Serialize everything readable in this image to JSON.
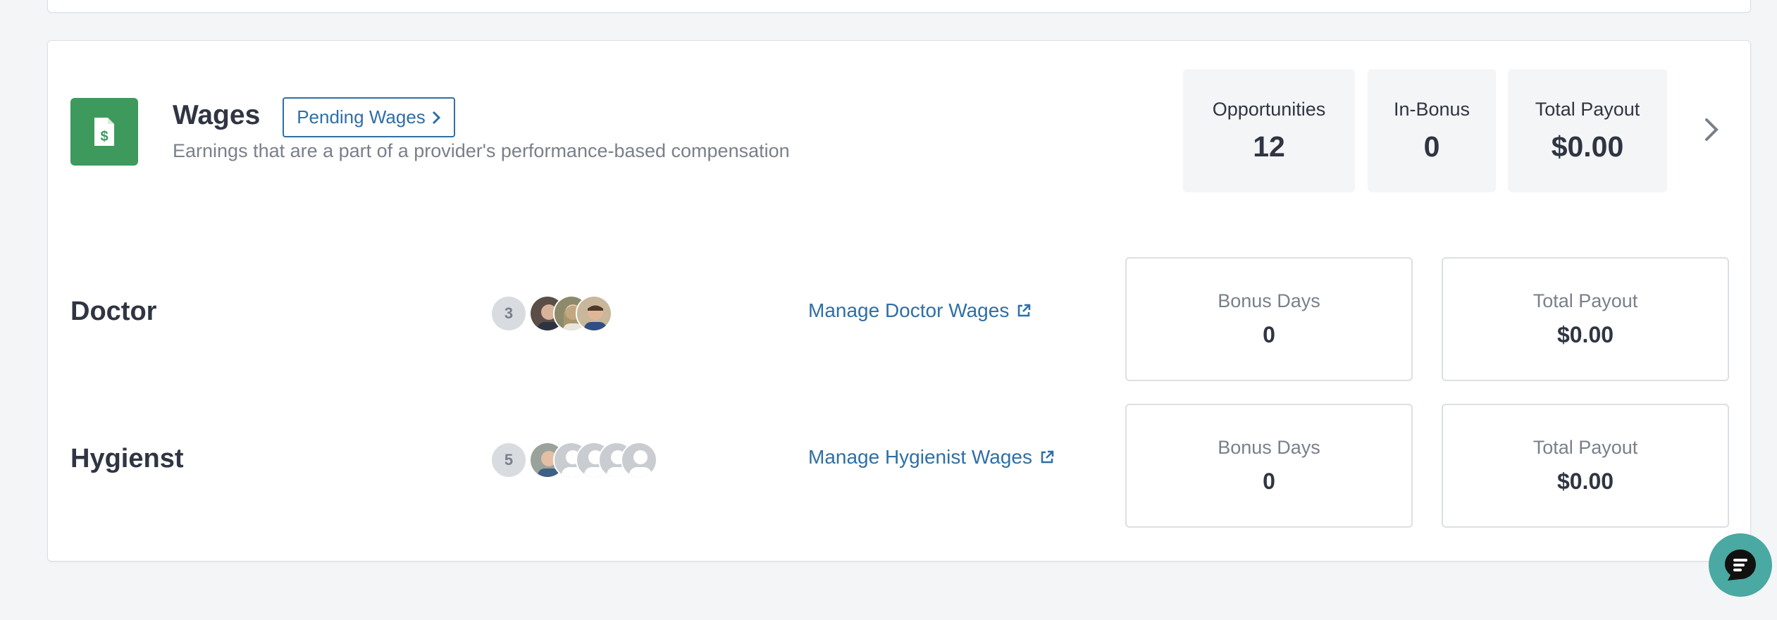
{
  "wages": {
    "title": "Wages",
    "pending_button": "Pending Wages",
    "subtitle": "Earnings that are a part of a provider's performance-based compensation",
    "stats": [
      {
        "label": "Opportunities",
        "value": "12"
      },
      {
        "label": "In-Bonus",
        "value": "0"
      },
      {
        "label": "Total Payout",
        "value": "$0.00"
      }
    ]
  },
  "rows": [
    {
      "label": "Doctor",
      "count": "3",
      "link": "Manage Doctor Wages",
      "bonus_days_label": "Bonus Days",
      "bonus_days": "0",
      "total_payout_label": "Total Payout",
      "total_payout": "$0.00"
    },
    {
      "label": "Hygienst",
      "count": "5",
      "link": "Manage Hygienist Wages",
      "bonus_days_label": "Bonus Days",
      "bonus_days": "0",
      "total_payout_label": "Total Payout",
      "total_payout": "$0.00"
    }
  ],
  "colors": {
    "accent_green": "#3d9a5c",
    "link_blue": "#2f6fa5",
    "chat_teal": "#4aa9a2"
  },
  "icons": {
    "wage_icon": "document-dollar-icon",
    "pending_chevron": "chevron-right-icon",
    "expand": "chevron-right-icon",
    "external_link": "external-link-icon",
    "chat": "chat-bubble-icon"
  }
}
